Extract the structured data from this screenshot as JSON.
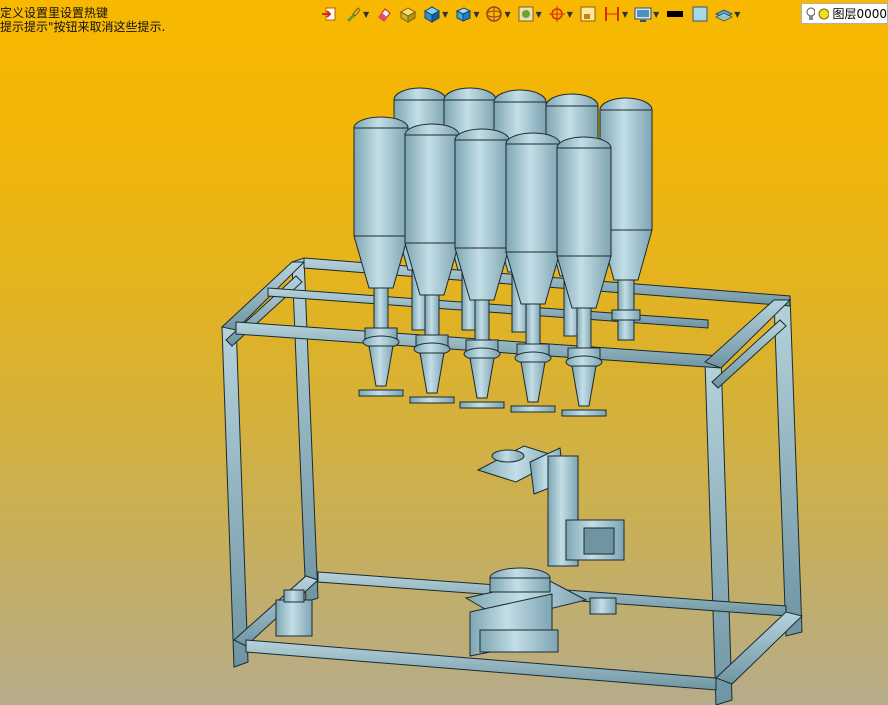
{
  "hint": {
    "line1": "定义设置里设置热键",
    "line2": "提示提示\"按钮来取消这些提示."
  },
  "toolbar": {
    "items": [
      {
        "icon": "exit-sketch-icon",
        "dropdown": false
      },
      {
        "icon": "paint-brush-icon",
        "dropdown": true
      },
      {
        "icon": "eraser-icon",
        "dropdown": false
      },
      {
        "icon": "box-solid-icon",
        "dropdown": false
      },
      {
        "icon": "cube-shaded-icon",
        "dropdown": true
      },
      {
        "icon": "cube-view-icon",
        "dropdown": true
      },
      {
        "icon": "sphere-orient-icon",
        "dropdown": true
      },
      {
        "icon": "render-mode-icon",
        "dropdown": true
      },
      {
        "icon": "target-crosshair-icon",
        "dropdown": true
      },
      {
        "icon": "frame-icon",
        "dropdown": false
      },
      {
        "icon": "dimension-icon",
        "dropdown": true
      },
      {
        "icon": "display-settings-icon",
        "dropdown": true
      },
      {
        "icon": "line-color-icon",
        "dropdown": false
      },
      {
        "icon": "fill-color-icon",
        "dropdown": false
      },
      {
        "icon": "layer-stack-icon",
        "dropdown": true
      }
    ]
  },
  "layer": {
    "label": "图层0000"
  },
  "colors": {
    "bg_top": "#f8b800",
    "bg_bottom": "#b6ac8a",
    "model_fill": "#9ec3cf",
    "model_line": "#1b2a30"
  }
}
